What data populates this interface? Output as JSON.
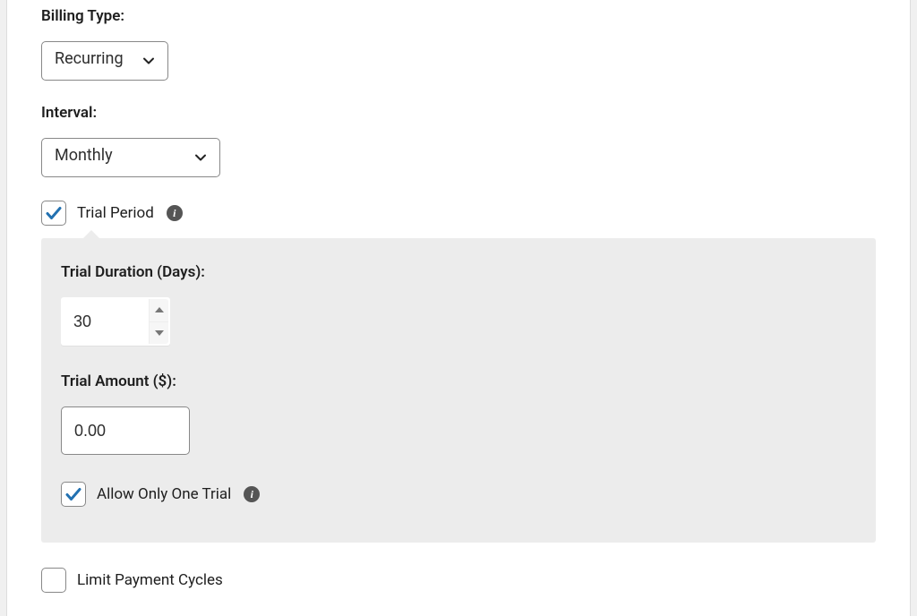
{
  "billing": {
    "label": "Billing Type:",
    "value": "Recurring"
  },
  "interval": {
    "label": "Interval:",
    "value": "Monthly"
  },
  "trialPeriod": {
    "label": "Trial Period",
    "checked": true
  },
  "trialDuration": {
    "label": "Trial Duration (Days):",
    "value": "30"
  },
  "trialAmount": {
    "label": "Trial Amount ($):",
    "value": "0.00"
  },
  "allowOneTrial": {
    "label": "Allow Only One Trial",
    "checked": true
  },
  "limitCycles": {
    "label": "Limit Payment Cycles",
    "checked": false
  }
}
